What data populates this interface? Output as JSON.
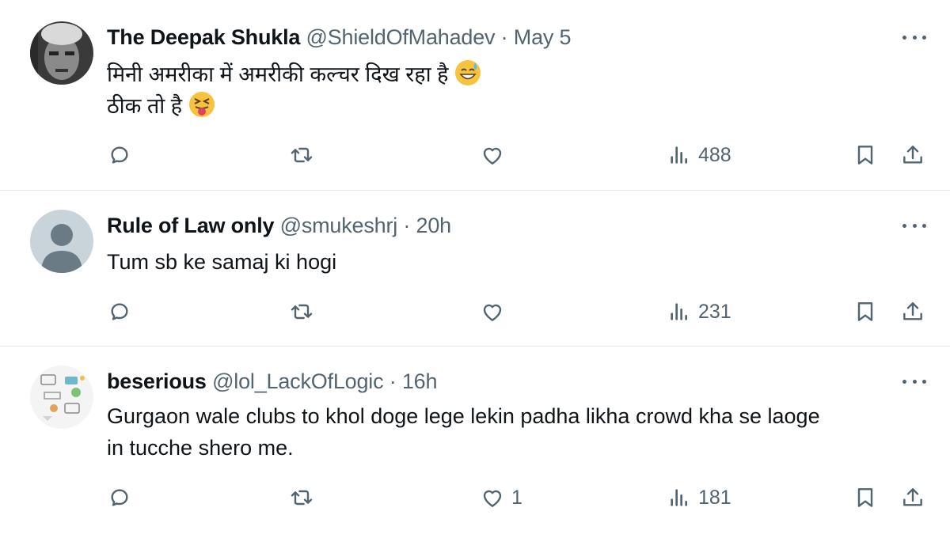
{
  "tweets": [
    {
      "name": "The Deepak Shukla",
      "handle": "@ShieldOfMahadev",
      "sep": "·",
      "time": "May 5",
      "lines": [
        "मिनी अमरीका में अमरीकी कल्चर दिख रहा है",
        "ठीक तो है"
      ],
      "emojis": [
        "grinning-sweat-emoji",
        "squinting-tongue-emoji"
      ],
      "likes": "",
      "views": "488"
    },
    {
      "name": "Rule of Law only",
      "handle": "@smukeshrj",
      "sep": "·",
      "time": "20h",
      "lines": [
        "Tum sb ke samaj ki hogi"
      ],
      "likes": "",
      "views": "231"
    },
    {
      "name": "beserious",
      "handle": "@lol_LackOfLogic",
      "sep": "·",
      "time": "16h",
      "lines": [
        "Gurgaon wale clubs to khol doge lege lekin padha likha crowd kha se laoge",
        "in tucche shero me."
      ],
      "likes": "1",
      "views": "181"
    }
  ],
  "icons": {
    "reply": "reply-icon",
    "retweet": "retweet-icon",
    "like": "heart-icon",
    "views": "views-icon",
    "bookmark": "bookmark-icon",
    "share": "share-icon",
    "more": "more-icon"
  },
  "colors": {
    "text": "#0f1419",
    "secondary": "#536471",
    "divider": "#e6e9eb"
  }
}
